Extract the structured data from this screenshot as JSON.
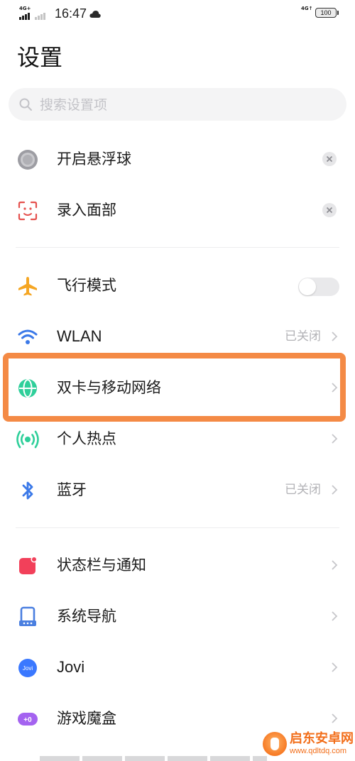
{
  "status_bar": {
    "network_left_1": "4G+",
    "time": "16:47",
    "network_right": "4G↑",
    "battery": "100"
  },
  "page": {
    "title": "设置"
  },
  "search": {
    "placeholder": "搜索设置项",
    "value": ""
  },
  "suggestions": [
    {
      "label": "开启悬浮球",
      "icon": "floating-ball-icon"
    },
    {
      "label": "录入面部",
      "icon": "face-scan-icon"
    }
  ],
  "network_items": [
    {
      "label": "飞行模式",
      "icon": "airplane-icon",
      "control": "toggle",
      "toggle_on": false
    },
    {
      "label": "WLAN",
      "icon": "wifi-icon",
      "value": "已关闭"
    },
    {
      "label": "双卡与移动网络",
      "icon": "globe-icon"
    },
    {
      "label": "个人热点",
      "icon": "hotspot-icon"
    },
    {
      "label": "蓝牙",
      "icon": "bluetooth-icon",
      "value": "已关闭"
    }
  ],
  "system_items": [
    {
      "label": "状态栏与通知",
      "icon": "notification-icon"
    },
    {
      "label": "系统导航",
      "icon": "navigation-icon"
    },
    {
      "label": "Jovi",
      "icon": "jovi-icon",
      "icon_text": "Jovi"
    },
    {
      "label": "游戏魔盒",
      "icon": "game-box-icon",
      "icon_text": "+0"
    }
  ],
  "watermark": {
    "name": "启东安卓网",
    "url": "www.qdltdq.com"
  },
  "colors": {
    "highlight_border": "#f48a45",
    "airplane": "#f5a623",
    "wifi": "#3b79e8",
    "globe": "#2fcf9a",
    "hotspot": "#2fcf9a",
    "bluetooth": "#3b79e8",
    "notification": "#f2405a",
    "navigation": "#4a7fe0",
    "jovi": "#3a78ff",
    "game_box": "#a463f0",
    "face_scan": "#e5514e"
  }
}
